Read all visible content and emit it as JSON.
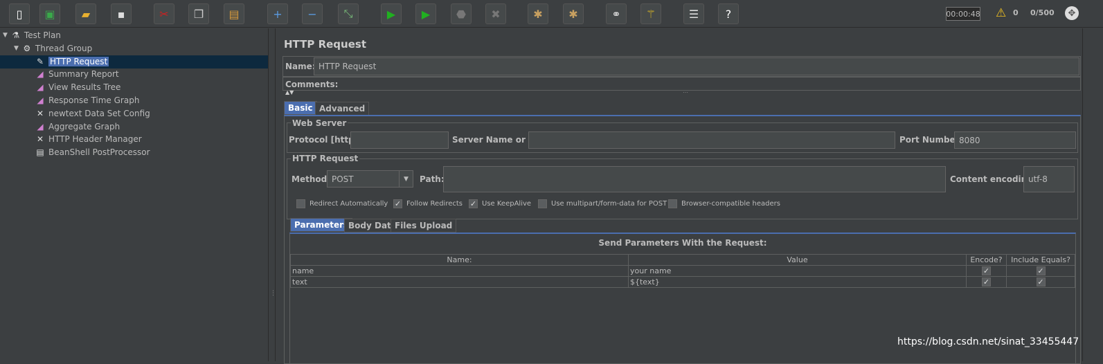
{
  "toolbar": {
    "buttons": [
      {
        "name": "new",
        "icon": "new-document-icon",
        "glyph": "▯",
        "color": "#ffffff"
      },
      {
        "name": "templates",
        "icon": "templates-icon",
        "glyph": "▣",
        "color": "#3aa84a"
      },
      {
        "name": "open",
        "icon": "open-folder-icon",
        "glyph": "▰",
        "color": "#e8b030"
      },
      {
        "name": "save",
        "icon": "save-icon",
        "glyph": "▪",
        "color": "#dddddd"
      },
      {
        "name": "cut",
        "icon": "scissors-icon",
        "glyph": "✂",
        "color": "#d02020"
      },
      {
        "name": "copy",
        "icon": "copy-icon",
        "glyph": "❐",
        "color": "#cccccc"
      },
      {
        "name": "paste",
        "icon": "clipboard-icon",
        "glyph": "▤",
        "color": "#d89a3a"
      },
      {
        "name": "expand",
        "icon": "plus-icon",
        "glyph": "+",
        "color": "#5b9be0"
      },
      {
        "name": "collapse",
        "icon": "minus-icon",
        "glyph": "−",
        "color": "#5b9be0"
      },
      {
        "name": "toggle",
        "icon": "toggle-icon",
        "glyph": "⤡",
        "color": "#7cc27c"
      },
      {
        "name": "start",
        "icon": "play-icon",
        "glyph": "▶",
        "color": "#20b020"
      },
      {
        "name": "start-no-pauses",
        "icon": "play-no-timers-icon",
        "glyph": "▶",
        "color": "#20b020"
      },
      {
        "name": "stop",
        "icon": "stop-icon",
        "glyph": "⬣",
        "color": "#777777"
      },
      {
        "name": "shutdown",
        "icon": "shutdown-icon",
        "glyph": "✖",
        "color": "#777777"
      },
      {
        "name": "clear",
        "icon": "clear-broom-icon",
        "glyph": "✱",
        "color": "#c8a060"
      },
      {
        "name": "clear-all",
        "icon": "clear-all-broom-icon",
        "glyph": "✱",
        "color": "#c8a060"
      },
      {
        "name": "search",
        "icon": "binoculars-icon",
        "glyph": "⚭",
        "color": "#dddddd"
      },
      {
        "name": "reset-search",
        "icon": "broom-icon",
        "glyph": "⚚",
        "color": "#e8c020"
      },
      {
        "name": "function-helper",
        "icon": "list-icon",
        "glyph": "☰",
        "color": "#dddddd"
      },
      {
        "name": "help",
        "icon": "help-book-icon",
        "glyph": "?",
        "color": "#ffffff"
      }
    ],
    "timer": "00:00:48",
    "warnings": "0",
    "threads": "0/500"
  },
  "tree": [
    {
      "label": "Test Plan",
      "icon": "test-plan-flask-icon",
      "glyph": "⚗",
      "level": 0,
      "arrow": "▼"
    },
    {
      "label": "Thread Group",
      "icon": "gear-icon",
      "glyph": "⚙",
      "level": 1,
      "arrow": "▼"
    },
    {
      "label": "HTTP Request",
      "icon": "pipette-sampler-icon",
      "glyph": "✎",
      "level": 2,
      "selected": true
    },
    {
      "label": "Summary Report",
      "icon": "graph-listener-icon",
      "glyph": "◢",
      "level": 2
    },
    {
      "label": "View Results Tree",
      "icon": "graph-listener-icon",
      "glyph": "◢",
      "level": 2
    },
    {
      "label": "Response Time Graph",
      "icon": "graph-listener-icon",
      "glyph": "◢",
      "level": 2
    },
    {
      "label": "newtext Data Set Config",
      "icon": "wrench-config-icon",
      "glyph": "✕",
      "level": 2
    },
    {
      "label": "Aggregate Graph",
      "icon": "graph-listener-icon",
      "glyph": "◢",
      "level": 2
    },
    {
      "label": "HTTP Header Manager",
      "icon": "wrench-config-icon",
      "glyph": "✕",
      "level": 2
    },
    {
      "label": "BeanShell PostProcessor",
      "icon": "document-icon",
      "glyph": "▤",
      "level": 2
    }
  ],
  "panel": {
    "title": "HTTP Request",
    "name_label": "Name:",
    "name_value": "HTTP Request",
    "comments_label": "Comments:",
    "tabs": [
      "Basic",
      "Advanced"
    ],
    "web_server": {
      "legend": "Web Server",
      "protocol_label": "Protocol [http]:",
      "protocol_value": "",
      "server_label": "Server Name or IP:",
      "server_value": "",
      "port_label": "Port Number:",
      "port_value": "8080"
    },
    "http_request": {
      "legend": "HTTP Request",
      "method_label": "Method:",
      "method_value": "POST",
      "path_label": "Path:",
      "path_value": "",
      "encoding_label": "Content encoding:",
      "encoding_value": "utf-8"
    },
    "checkboxes": [
      {
        "label": "Redirect Automatically",
        "checked": false
      },
      {
        "label": "Follow Redirects",
        "checked": true
      },
      {
        "label": "Use KeepAlive",
        "checked": true
      },
      {
        "label": "Use multipart/form-data for POST",
        "checked": false
      },
      {
        "label": "Browser-compatible headers",
        "checked": false
      }
    ],
    "sub_tabs": [
      "Parameters",
      "Body Data",
      "Files Upload"
    ],
    "params_title": "Send Parameters With the Request:",
    "columns": [
      "Name:",
      "Value",
      "Encode?",
      "Include Equals?"
    ],
    "rows": [
      {
        "name": "name",
        "value": "your name",
        "encode": true,
        "include_equals": true
      },
      {
        "name": "text",
        "value": "${text}",
        "encode": true,
        "include_equals": true
      }
    ]
  },
  "watermark": "https://blog.csdn.net/sinat_33455447"
}
